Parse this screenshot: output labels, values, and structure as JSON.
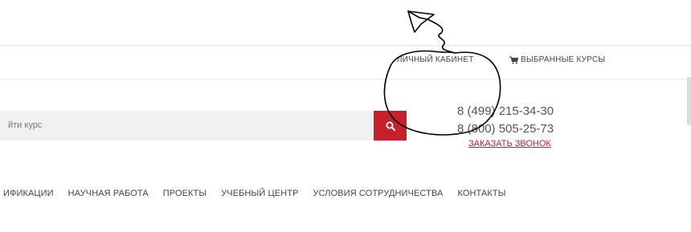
{
  "topbar": {
    "cabinet_label": "ЛИЧНЫЙ КАБИНЕТ",
    "courses_label": "ВЫБРАННЫЕ КУРСЫ",
    "courses_icon": "cart-icon"
  },
  "search": {
    "placeholder": "йти курс",
    "button_icon": "search-icon"
  },
  "contacts": {
    "phone_1": "8 (499) 215-34-30",
    "phone_2": "8 (800) 505-25-73",
    "callback_label": "ЗАКАЗАТЬ ЗВОНОК"
  },
  "nav": {
    "items": [
      "ИФИКАЦИИ",
      "НАУЧНАЯ РАБОТА",
      "ПРОЕКТЫ",
      "УЧЕБНЫЙ ЦЕНТР",
      "УСЛОВИЯ СОТРУДНИЧЕСТВА",
      "КОНТАКТЫ"
    ]
  },
  "colors": {
    "accent": "#c6202b",
    "text": "#444444",
    "search_bg": "#f1f1f1",
    "annotation_ink": "#000000"
  }
}
